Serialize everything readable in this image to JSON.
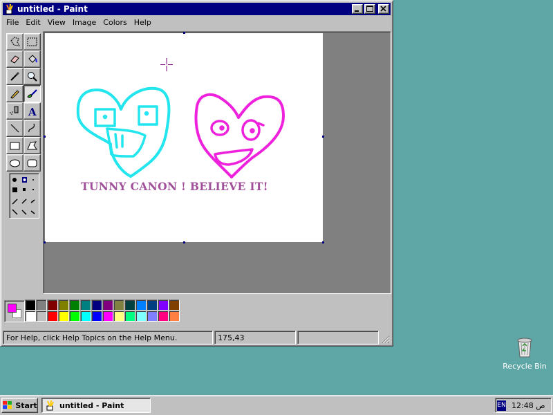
{
  "window": {
    "title": "untitled - Paint",
    "menu": [
      "File",
      "Edit",
      "View",
      "Image",
      "Colors",
      "Help"
    ]
  },
  "tools": [
    {
      "name": "free-form-select-tool-icon",
      "active": false
    },
    {
      "name": "select-tool-icon",
      "active": false
    },
    {
      "name": "eraser-tool-icon",
      "active": false
    },
    {
      "name": "fill-with-color-tool-icon",
      "active": false
    },
    {
      "name": "pick-color-tool-icon",
      "active": false
    },
    {
      "name": "magnifier-tool-icon",
      "active": false
    },
    {
      "name": "pencil-tool-icon",
      "active": false
    },
    {
      "name": "brush-tool-icon",
      "active": true
    },
    {
      "name": "airbrush-tool-icon",
      "active": false
    },
    {
      "name": "text-tool-icon",
      "active": false
    },
    {
      "name": "line-tool-icon",
      "active": false
    },
    {
      "name": "curve-tool-icon",
      "active": false
    },
    {
      "name": "rectangle-tool-icon",
      "active": false
    },
    {
      "name": "polygon-tool-icon",
      "active": false
    },
    {
      "name": "ellipse-tool-icon",
      "active": false
    },
    {
      "name": "rounded-rectangle-tool-icon",
      "active": false
    }
  ],
  "canvas": {
    "text": "TUNNY CANON ! BELIEVE IT!",
    "text_color": "#a0509a",
    "heart_left_color": "#22e5ee",
    "heart_right_color": "#ee22dd"
  },
  "current_colors": {
    "foreground": "#ff00ff",
    "background": "#ffffff"
  },
  "palette": [
    "#000000",
    "#808080",
    "#800000",
    "#808000",
    "#008000",
    "#008080",
    "#000080",
    "#800080",
    "#808040",
    "#004040",
    "#0080ff",
    "#004080",
    "#8000ff",
    "#804000",
    "#ffffff",
    "#c0c0c0",
    "#ff0000",
    "#ffff00",
    "#00ff00",
    "#00ffff",
    "#0000ff",
    "#ff00ff",
    "#ffff80",
    "#00ff80",
    "#80ffff",
    "#8080ff",
    "#ff0080",
    "#ff8040"
  ],
  "statusbar": {
    "help": "For Help, click Help Topics on the Help Menu.",
    "coords": "175,43",
    "size": ""
  },
  "desktop": {
    "recycle_bin_label": "Recycle Bin"
  },
  "taskbar": {
    "start_label": "Start",
    "task_label": "untitled - Paint",
    "lang": "EN",
    "clock": "12:48 ص"
  }
}
